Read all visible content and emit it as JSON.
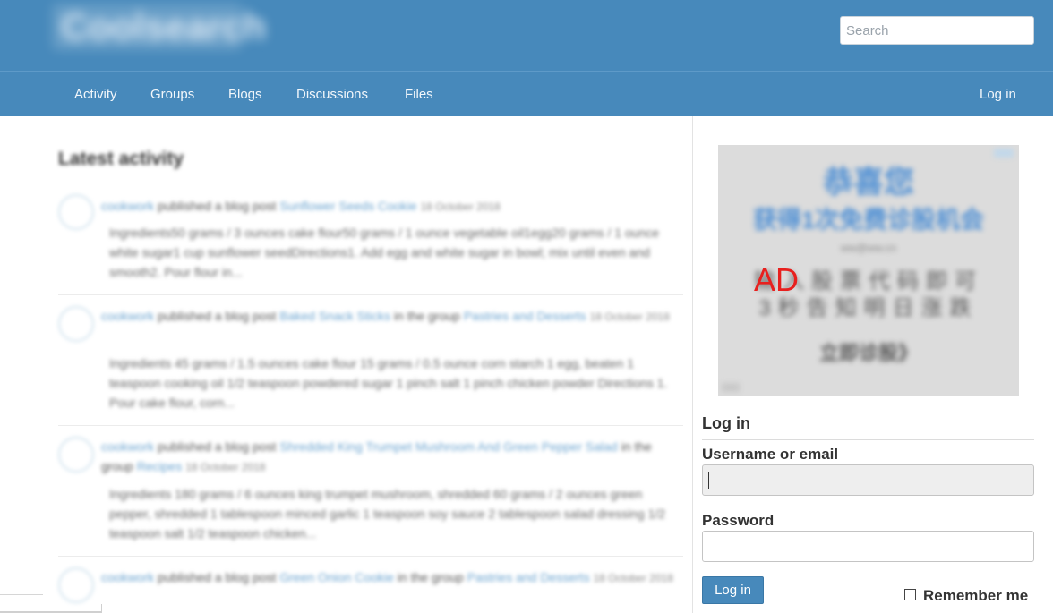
{
  "header": {
    "logo_text": "Coolsearch",
    "search_placeholder": "Search"
  },
  "nav": {
    "items": [
      "Activity",
      "Groups",
      "Blogs",
      "Discussions",
      "Files"
    ],
    "login": "Log in"
  },
  "main": {
    "heading": "Latest activity",
    "items": [
      {
        "user": "cookwork",
        "action": "published a blog post",
        "title": "Sunflower Seeds Cookie",
        "group_prefix": "",
        "group": "",
        "date": "18 October 2018",
        "excerpt": "Ingredients50 grams / 3 ounces cake flour50 grams / 1 ounce vegetable oil1egg20 grams / 1 ounce white sugar1 cup sunflower seedDirections1. Add egg and white sugar in bowl; mix until even and smooth2. Pour flour in..."
      },
      {
        "user": "cookwork",
        "action": "published a blog post",
        "title": "Baked Snack Sticks",
        "group_prefix": "in the group",
        "group": "Pastries and Desserts",
        "date": "18 October 2018",
        "excerpt": "Ingredients 45 grams / 1.5 ounces cake flour 15 grams / 0.5 ounce corn starch 1 egg, beaten 1 teaspoon cooking oil 1/2 teaspoon powdered sugar 1 pinch salt 1 pinch chicken powder Directions 1. Pour cake flour, corn..."
      },
      {
        "user": "cookwork",
        "action": "published a blog post",
        "title": "Shredded King Trumpet Mushroom And Green Pepper Salad",
        "group_prefix": "in the group",
        "group": "Recipes",
        "date": "18 October 2018",
        "excerpt": "Ingredients 180 grams / 6 ounces king trumpet mushroom, shredded 60 grams / 2 ounces green pepper, shredded 1 tablespoon minced garlic 1 teaspoon soy sauce 2 tablespoon salad dressing 1/2 teaspoon salt 1/2 teaspoon chicken..."
      },
      {
        "user": "cookwork",
        "action": "published a blog post",
        "title": "Green Onion Cookie",
        "group_prefix": "in the group",
        "group": "Pastries and Desserts",
        "date": "18 October 2018",
        "excerpt": ""
      }
    ]
  },
  "ad": {
    "line1": "恭喜您",
    "line2": "获得1次免费诊股机会",
    "line3": "ww@ww.cn",
    "line4": "输入股票代码即可",
    "line5": "3秒告知明日涨跌",
    "line6": "立即诊股》",
    "label": "AD"
  },
  "login": {
    "title": "Log in",
    "username_label": "Username or email",
    "username_value": "",
    "password_label": "Password",
    "password_value": "",
    "button": "Log in",
    "remember": "Remember me"
  }
}
